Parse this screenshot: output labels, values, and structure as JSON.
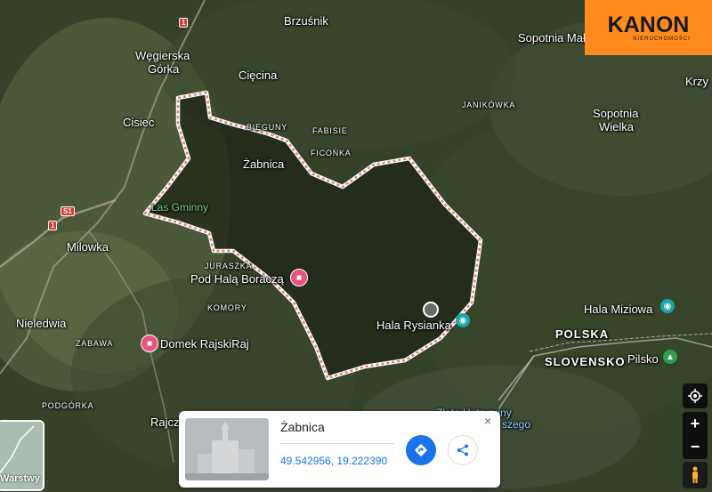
{
  "labels": {
    "brzusnik": "Brzuśnik",
    "wegierska1": "Węgierska",
    "wegierska2": "Górka",
    "ciecina": "Cięcina",
    "cisiec": "Cisiec",
    "bieguny": "BIEGUNY",
    "fabisie": "FABISIE",
    "ficonka": "FICOŃKA",
    "zabnica": "Żabnica",
    "janikowka": "JANIKÓWKA",
    "sopotnia_mala": "Sopotnia Mała",
    "sopotnia_wielka1": "Sopotnia",
    "sopotnia_wielka2": "Wielka",
    "krzy": "Krzy",
    "las_gminny": "Las Gminny",
    "milowka": "Milowka",
    "juraszka": "JURASZKA",
    "pod_hala": "Pod Halą Boraczą",
    "komory": "KOMORY",
    "nieledwia": "Nieledwia",
    "zabawa": "ZABAWA",
    "domek": "Domek RajskiRaj",
    "hala_rysianka": "Hala Rysianka",
    "hala_miziowa": "Hala Miziowa",
    "polska": "POLSKA",
    "slovensko": "SLOVENSKO",
    "pilsko": "Pilsko",
    "podgorka": "PODGÓRKA",
    "rajcz": "Rajcz",
    "zlota_huta1": "Złota Huta ruiny",
    "zlota_huta2": "szego"
  },
  "road_shields": {
    "r1_top": "1",
    "s1": "S1",
    "r1_left": "1"
  },
  "logo": {
    "main": "KANON",
    "sub": "NIERUCHOMOŚCI",
    "color": "#ff8b1f"
  },
  "controls": {
    "zoom_in": "+",
    "zoom_out": "−"
  },
  "layers_button": {
    "label": "Warstwy"
  },
  "place_card": {
    "title": "Żabnica",
    "coords": "49.542956, 19.222390",
    "close": "×"
  },
  "colors": {
    "boundary": "#e8a9a9",
    "accent": "#1a73e8"
  }
}
